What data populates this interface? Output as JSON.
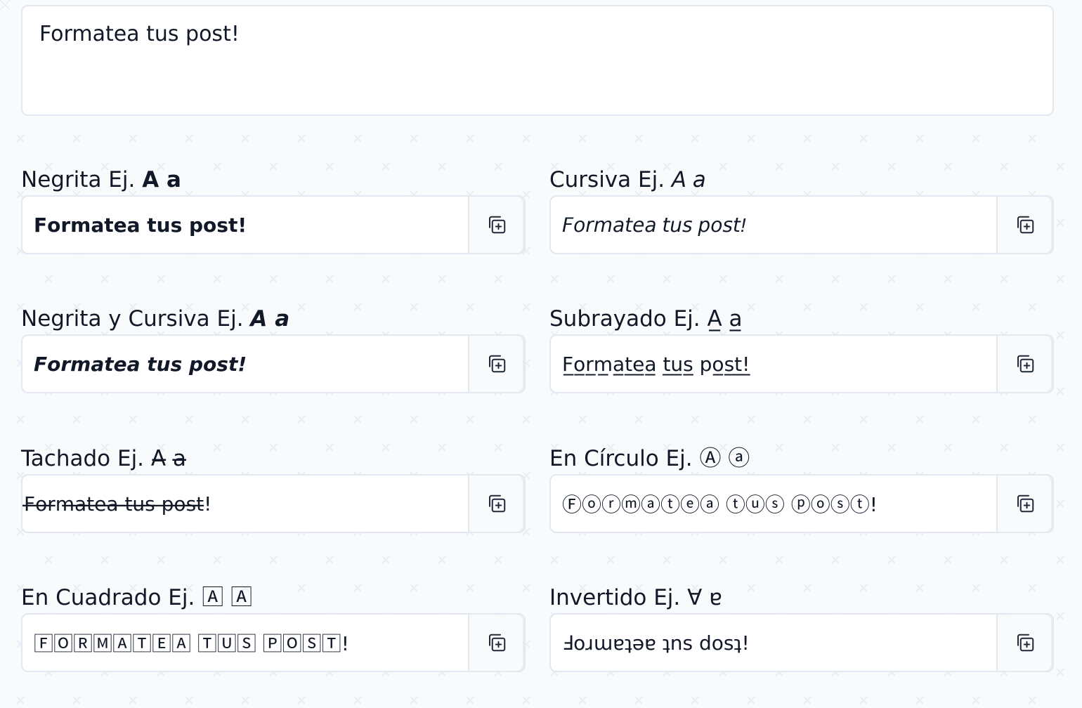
{
  "main_input": {
    "value": "Formatea tus post!"
  },
  "fields": {
    "bold": {
      "label": "Negrita Ej.",
      "sample": "𝗔 𝗮",
      "output": "𝗙𝗼𝗿𝗺𝗮𝘁𝗲𝗮 𝘁𝘂𝘀 𝗽𝗼𝘀𝘁!"
    },
    "italic": {
      "label": "Cursiva Ej.",
      "sample": "𝘈 𝘢",
      "output": "𝘍𝘰𝘳𝘮𝘢𝘵𝘦𝘢 𝘵𝘶𝘴 𝘱𝘰𝘴𝘵!"
    },
    "bold_italic": {
      "label": "Negrita y Cursiva Ej.",
      "sample": "𝘼 𝙖",
      "output": "𝙁𝙤𝙧𝙢𝙖𝙩𝙚𝙖 𝙩𝙪𝙨 𝙥𝙤𝙨𝙩!"
    },
    "underline": {
      "label": "Subrayado Ej.",
      "sample": "A̲ a̲",
      "output": "F̲o̲r̲m̲a̲t̲e̲a̲ t̲u̲s̲ p̲o̲s̲t̲!̲ "
    },
    "strike": {
      "label": "Tachado Ej.",
      "sample": " A̶ a̶",
      "output": "̶F̶o̶r̶m̶a̶t̶e̶a̶ ̶t̶u̶s̶ ̶p̶o̶s̶t̶!"
    },
    "circle": {
      "label": "En Círculo Ej.",
      "sample": "Ⓐ ⓐ",
      "output": "Ⓕⓞⓡⓜⓐⓣⓔⓐ ⓣⓤⓢ ⓟⓞⓢⓣ!"
    },
    "square": {
      "label": "En Cuadrado Ej.",
      "sample": "🄰 🄰",
      "output": "🄵🄾🅁🄼🄰🅃🄴🄰 🅃🅄🅂 🄿🄾🅂🅃!"
    },
    "inverted": {
      "label": "Invertido Ej.",
      "sample": "∀ ɐ",
      "output": "Ⅎoɹɯɐʇǝɐ ʇns dosʇ!"
    }
  },
  "icons": {
    "copy": "copy-icon"
  },
  "colors": {
    "text": "#111827",
    "border": "#e2e7f0",
    "background": "#f8fafc"
  }
}
